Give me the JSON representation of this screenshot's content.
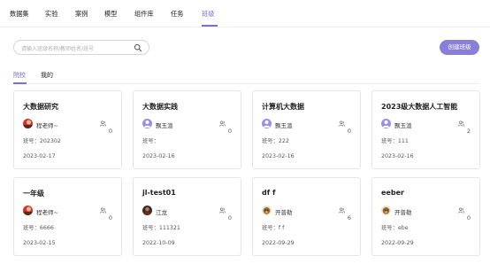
{
  "nav": {
    "items": [
      "数据集",
      "实验",
      "案例",
      "模型",
      "组件库",
      "任务",
      "班级"
    ],
    "active_index": 6
  },
  "search": {
    "placeholder": "请输入班级名称/教师姓名/班号",
    "icon": "search-icon"
  },
  "create_button": "创建班级",
  "tabs": [
    "院校",
    "我的"
  ],
  "colors": {
    "accent": "#7b6fd4",
    "button": "#8a7fd8",
    "avatar_default": "#9b8ee8"
  },
  "classes": [
    {
      "title": "大数据研究",
      "owner": "程老师~",
      "avatar": "photo-red",
      "members": "0",
      "code": "班号：202302",
      "date": "2023-02-17"
    },
    {
      "title": "大数据实践",
      "owner": "飘玉渲",
      "avatar": "default",
      "members": "0",
      "code": "班号：",
      "date": "2023-02-16"
    },
    {
      "title": "计算机大数据",
      "owner": "飘玉渲",
      "avatar": "default",
      "members": "0",
      "code": "班号：222",
      "date": "2023-02-16"
    },
    {
      "title": "2023级大数据人工智能",
      "owner": "飘玉渲",
      "avatar": "default",
      "members": "2",
      "code": "班号：111",
      "date": "2023-02-16"
    },
    {
      "title": "一年级",
      "owner": "程老师~",
      "avatar": "photo-red",
      "members": "0",
      "code": "班号：6666",
      "date": "2023-02-15"
    },
    {
      "title": "jl-test01",
      "owner": "江龙",
      "avatar": "photo-dark",
      "members": "0",
      "code": "班号：111321",
      "date": "2022-10-09"
    },
    {
      "title": "df f",
      "owner": "开普勒",
      "avatar": "photo-dog",
      "members": "6",
      "code": "班号：f f",
      "date": "2022-09-29"
    },
    {
      "title": "eeber",
      "owner": "开普勒",
      "avatar": "photo-dog",
      "members": "0",
      "code": "班号：ebe",
      "date": "2022-09-29"
    }
  ]
}
